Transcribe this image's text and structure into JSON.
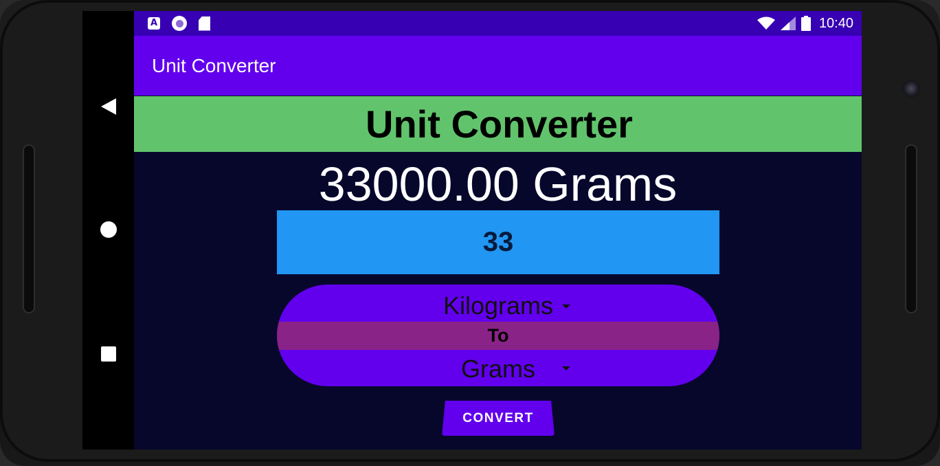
{
  "status_bar": {
    "time": "10:40",
    "icons": [
      "accessibility-a-icon",
      "circle-notification-icon",
      "sd-card-icon",
      "wifi-icon",
      "signal-icon",
      "battery-icon"
    ]
  },
  "nav_bar": {
    "buttons": [
      "back-icon",
      "home-icon",
      "recents-icon"
    ]
  },
  "action_bar": {
    "title": "Unit Converter"
  },
  "main": {
    "header": "Unit Converter",
    "result": "33000.00 Grams",
    "input_value": "33",
    "from_unit": "Kilograms",
    "separator": "To",
    "to_unit": "Grams",
    "convert_label": "CONVERT"
  },
  "colors": {
    "status_bar": "#3700b3",
    "action_bar": "#6200ee",
    "header_banner": "#61c46c",
    "background": "#07072c",
    "input_box": "#2196f3",
    "selector_pill": "#6200ee",
    "to_band": "#8a2387",
    "convert_button": "#6200ee"
  }
}
